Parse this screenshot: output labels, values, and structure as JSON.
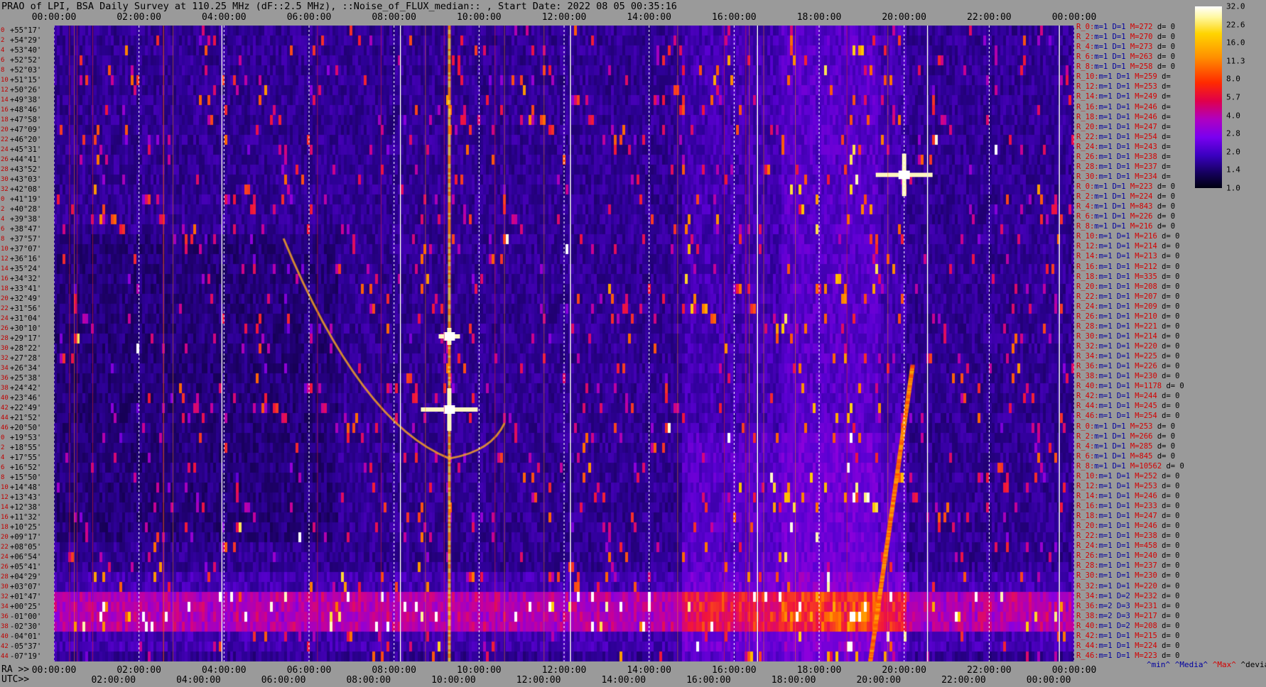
{
  "title": "PRAO of LPI, BSA Daily Survey at 110.25 MHz (dF::2.5 MHz), ::Noise_of_FLUX_median:: , Start Date: 2022 08 05 00:35:16",
  "axis_prefix": {
    "ra": "RA >>",
    "utc": "UTC>>"
  },
  "legend": {
    "min": "^min^",
    "median": "^Media^",
    "max": "^Max^",
    "devia": "^devia^"
  },
  "colors": {
    "background": "#9a9a9a",
    "label_red": "#d40000",
    "label_blue": "#0000a0"
  },
  "chart_data": {
    "type": "heatmap",
    "title": "PRAO of LPI, BSA Daily Survey at 110.25 MHz (dF::2.5 MHz), ::Noise_of_FLUX_median:: , Start Date: 2022 08 05 00:35:16",
    "x_top_ticks": [
      "00:00:00",
      "02:00:00",
      "04:00:00",
      "06:00:00",
      "08:00:00",
      "10:00:00",
      "12:00:00",
      "14:00:00",
      "16:00:00",
      "18:00:00",
      "20:00:00",
      "22:00:00",
      "00:00:00"
    ],
    "x_ra_bottom_ticks": [
      "00:00:00",
      "02:00:00",
      "04:00:00",
      "06:00:00",
      "08:00:00",
      "10:00:00",
      "12:00:00",
      "14:00:00",
      "16:00:00",
      "18:00:00",
      "20:00:00",
      "22:00:00",
      "00:00:00"
    ],
    "x_utc_bottom_ticks": [
      "02:00:00",
      "04:00:00",
      "06:00:00",
      "08:00:00",
      "10:00:00",
      "12:00:00",
      "14:00:00",
      "16:00:00",
      "18:00:00",
      "20:00:00",
      "22:00:00",
      "00:00:00"
    ],
    "x_range_hours": [
      0,
      24
    ],
    "y_ticks": [
      "+55°17'",
      "+54°29'",
      "+53°40'",
      "+52°52'",
      "+52°03'",
      "+51°15'",
      "+50°26'",
      "+49°38'",
      "+48°46'",
      "+47°58'",
      "+47°09'",
      "+46°20'",
      "+45°31'",
      "+44°41'",
      "+43°52'",
      "+43°03'",
      "+42°08'",
      "+41°19'",
      "+40°28'",
      "+39°38'",
      "+38°47'",
      "+37°57'",
      "+37°07'",
      "+36°16'",
      "+35°24'",
      "+34°32'",
      "+33°41'",
      "+32°49'",
      "+31°56'",
      "+31°04'",
      "+30°10'",
      "+29°17'",
      "+28°22'",
      "+27°28'",
      "+26°34'",
      "+25°38'",
      "+24°42'",
      "+23°46'",
      "+22°49'",
      "+21°52'",
      "+20°50'",
      "+19°53'",
      "+18°55'",
      "+17°55'",
      "+16°52'",
      "+15°50'",
      "+14°48'",
      "+13°43'",
      "+12°38'",
      "+11°32'",
      "+10°25'",
      "+09°17'",
      "+08°05'",
      "+06°54'",
      "+05°41'",
      "+04°29'",
      "+03°07'",
      "+01°47'",
      "+00°25'",
      "-01°00'",
      "-02°30'",
      "-04°01'",
      "-05°37'",
      "-07°19'"
    ],
    "row_index_labels": [
      "0",
      "2",
      "4",
      "6",
      "8",
      "10",
      "12",
      "14",
      "16",
      "18",
      "20",
      "22",
      "24",
      "26",
      "28",
      "30",
      "32",
      "0",
      "2",
      "4",
      "6",
      "8",
      "10",
      "12",
      "14",
      "16",
      "18",
      "20",
      "22",
      "24",
      "26",
      "28",
      "30",
      "32",
      "34",
      "36",
      "38",
      "40",
      "42",
      "44",
      "46",
      "0",
      "2",
      "4",
      "6",
      "8",
      "10",
      "12",
      "14",
      "16",
      "18",
      "20",
      "22",
      "24",
      "26",
      "28",
      "30",
      "32",
      "34",
      "36",
      "38",
      "40",
      "42",
      "44"
    ],
    "colorbar": {
      "ticks": [
        "32.0",
        "22.6",
        "16.0",
        "11.3",
        "8.0",
        "5.7",
        "4.0",
        "2.8",
        "2.0",
        "1.4",
        "1.0"
      ],
      "range": [
        1.0,
        32.0
      ],
      "scale": "log"
    },
    "sources": [
      {
        "ra_hours": 9.3,
        "dec_deg": 17.5,
        "label": "bright"
      },
      {
        "ra_hours": 20.0,
        "dec_deg": 40.6,
        "label": "bright"
      },
      {
        "ra_hours": 9.3,
        "dec_deg": 24.7,
        "label": "medium"
      }
    ],
    "grid": true
  },
  "stats": [
    {
      "r": "R_0:",
      "m": "m=1",
      "D": "D=1",
      "M": "M=272",
      "d": "d= 0"
    },
    {
      "r": "R_2:",
      "m": "m=1",
      "D": "D=1",
      "M": "M=270",
      "d": "d= 0"
    },
    {
      "r": "R_4:",
      "m": "m=1",
      "D": "D=1",
      "M": "M=273",
      "d": "d= 0"
    },
    {
      "r": "R_6:",
      "m": "m=1",
      "D": "D=1",
      "M": "M=263",
      "d": "d= 0"
    },
    {
      "r": "R_8:",
      "m": "m=1",
      "D": "D=1",
      "M": "M=258",
      "d": "d= 0"
    },
    {
      "r": "R_10:",
      "m": "m=1",
      "D": "D=1",
      "M": "M=259",
      "d": "d="
    },
    {
      "r": "R_12:",
      "m": "m=1",
      "D": "D=1",
      "M": "M=253",
      "d": "d="
    },
    {
      "r": "R_14:",
      "m": "m=1",
      "D": "D=1",
      "M": "M=249",
      "d": "d="
    },
    {
      "r": "R_16:",
      "m": "m=1",
      "D": "D=1",
      "M": "M=246",
      "d": "d="
    },
    {
      "r": "R_18:",
      "m": "m=1",
      "D": "D=1",
      "M": "M=246",
      "d": "d="
    },
    {
      "r": "R_20:",
      "m": "m=1",
      "D": "D=1",
      "M": "M=247",
      "d": "d="
    },
    {
      "r": "R_22:",
      "m": "m=1",
      "D": "D=1",
      "M": "M=254",
      "d": "d="
    },
    {
      "r": "R_24:",
      "m": "m=1",
      "D": "D=1",
      "M": "M=243",
      "d": "d="
    },
    {
      "r": "R_26:",
      "m": "m=1",
      "D": "D=1",
      "M": "M=238",
      "d": "d="
    },
    {
      "r": "R_28:",
      "m": "m=1",
      "D": "D=1",
      "M": "M=237",
      "d": "d="
    },
    {
      "r": "R_30:",
      "m": "m=1",
      "D": "D=1",
      "M": "M=234",
      "d": "d="
    },
    {
      "r": "R_0:",
      "m": "m=1",
      "D": "D=1",
      "M": "M=223",
      "d": "d= 0"
    },
    {
      "r": "R_2:",
      "m": "m=1",
      "D": "D=1",
      "M": "M=224",
      "d": "d= 0"
    },
    {
      "r": "R_4:",
      "m": "m=1",
      "D": "D=1",
      "M": "M=843",
      "d": "d= 0"
    },
    {
      "r": "R_6:",
      "m": "m=1",
      "D": "D=1",
      "M": "M=226",
      "d": "d= 0"
    },
    {
      "r": "R_8:",
      "m": "m=1",
      "D": "D=1",
      "M": "M=216",
      "d": "d= 0"
    },
    {
      "r": "R_10:",
      "m": "m=1",
      "D": "D=1",
      "M": "M=216",
      "d": "d= 0"
    },
    {
      "r": "R_12:",
      "m": "m=1",
      "D": "D=1",
      "M": "M=214",
      "d": "d= 0"
    },
    {
      "r": "R_14:",
      "m": "m=1",
      "D": "D=1",
      "M": "M=213",
      "d": "d= 0"
    },
    {
      "r": "R_16:",
      "m": "m=1",
      "D": "D=1",
      "M": "M=212",
      "d": "d= 0"
    },
    {
      "r": "R_18:",
      "m": "m=1",
      "D": "D=1",
      "M": "M=335",
      "d": "d= 0"
    },
    {
      "r": "R_20:",
      "m": "m=1",
      "D": "D=1",
      "M": "M=208",
      "d": "d= 0"
    },
    {
      "r": "R_22:",
      "m": "m=1",
      "D": "D=1",
      "M": "M=207",
      "d": "d= 0"
    },
    {
      "r": "R_24:",
      "m": "m=1",
      "D": "D=1",
      "M": "M=209",
      "d": "d= 0"
    },
    {
      "r": "R_26:",
      "m": "m=1",
      "D": "D=1",
      "M": "M=210",
      "d": "d= 0"
    },
    {
      "r": "R_28:",
      "m": "m=1",
      "D": "D=1",
      "M": "M=221",
      "d": "d= 0"
    },
    {
      "r": "R_30:",
      "m": "m=1",
      "D": "D=1",
      "M": "M=214",
      "d": "d= 0"
    },
    {
      "r": "R_32:",
      "m": "m=1",
      "D": "D=1",
      "M": "M=220",
      "d": "d= 0"
    },
    {
      "r": "R_34:",
      "m": "m=1",
      "D": "D=1",
      "M": "M=225",
      "d": "d= 0"
    },
    {
      "r": "R_36:",
      "m": "m=1",
      "D": "D=1",
      "M": "M=226",
      "d": "d= 0"
    },
    {
      "r": "R_38:",
      "m": "m=1",
      "D": "D=1",
      "M": "M=230",
      "d": "d= 0"
    },
    {
      "r": "R_40:",
      "m": "m=1",
      "D": "D=1",
      "M": "M=1178",
      "d": "d= 0"
    },
    {
      "r": "R_42:",
      "m": "m=1",
      "D": "D=1",
      "M": "M=244",
      "d": "d= 0"
    },
    {
      "r": "R_44:",
      "m": "m=1",
      "D": "D=1",
      "M": "M=245",
      "d": "d= 0"
    },
    {
      "r": "R_46:",
      "m": "m=1",
      "D": "D=1",
      "M": "M=254",
      "d": "d= 0"
    },
    {
      "r": "R_0:",
      "m": "m=1",
      "D": "D=1",
      "M": "M=253",
      "d": "d= 0"
    },
    {
      "r": "R_2:",
      "m": "m=1",
      "D": "D=1",
      "M": "M=266",
      "d": "d= 0"
    },
    {
      "r": "R_4:",
      "m": "m=1",
      "D": "D=1",
      "M": "M=285",
      "d": "d= 0"
    },
    {
      "r": "R_6:",
      "m": "m=1",
      "D": "D=1",
      "M": "M=845",
      "d": "d= 0"
    },
    {
      "r": "R_8:",
      "m": "m=1",
      "D": "D=1",
      "M": "M=10562",
      "d": "d= 0"
    },
    {
      "r": "R_10:",
      "m": "m=1",
      "D": "D=1",
      "M": "M=252",
      "d": "d= 0"
    },
    {
      "r": "R_12:",
      "m": "m=1",
      "D": "D=1",
      "M": "M=253",
      "d": "d= 0"
    },
    {
      "r": "R_14:",
      "m": "m=1",
      "D": "D=1",
      "M": "M=246",
      "d": "d= 0"
    },
    {
      "r": "R_16:",
      "m": "m=1",
      "D": "D=1",
      "M": "M=233",
      "d": "d= 0"
    },
    {
      "r": "R_18:",
      "m": "m=1",
      "D": "D=1",
      "M": "M=247",
      "d": "d= 0"
    },
    {
      "r": "R_20:",
      "m": "m=1",
      "D": "D=1",
      "M": "M=246",
      "d": "d= 0"
    },
    {
      "r": "R_22:",
      "m": "m=1",
      "D": "D=1",
      "M": "M=238",
      "d": "d= 0"
    },
    {
      "r": "R_24:",
      "m": "m=1",
      "D": "D=1",
      "M": "M=458",
      "d": "d= 0"
    },
    {
      "r": "R_26:",
      "m": "m=1",
      "D": "D=1",
      "M": "M=240",
      "d": "d= 0"
    },
    {
      "r": "R_28:",
      "m": "m=1",
      "D": "D=1",
      "M": "M=237",
      "d": "d= 0"
    },
    {
      "r": "R_30:",
      "m": "m=1",
      "D": "D=1",
      "M": "M=230",
      "d": "d= 0"
    },
    {
      "r": "R_32:",
      "m": "m=1",
      "D": "D=1",
      "M": "M=220",
      "d": "d= 0"
    },
    {
      "r": "R_34:",
      "m": "m=1",
      "D": "D=2",
      "M": "M=232",
      "d": "d= 0"
    },
    {
      "r": "R_36:",
      "m": "m=2",
      "D": "D=3",
      "M": "M=231",
      "d": "d= 0"
    },
    {
      "r": "R_38:",
      "m": "m=2",
      "D": "D=3",
      "M": "M=217",
      "d": "d= 0"
    },
    {
      "r": "R_40:",
      "m": "m=1",
      "D": "D=2",
      "M": "M=208",
      "d": "d= 0"
    },
    {
      "r": "R_42:",
      "m": "m=1",
      "D": "D=1",
      "M": "M=215",
      "d": "d= 0"
    },
    {
      "r": "R_44:",
      "m": "m=1",
      "D": "D=1",
      "M": "M=224",
      "d": "d= 0"
    },
    {
      "r": "R_46:",
      "m": "m=1",
      "D": "D=1",
      "M": "M=223",
      "d": "d= 0"
    }
  ]
}
